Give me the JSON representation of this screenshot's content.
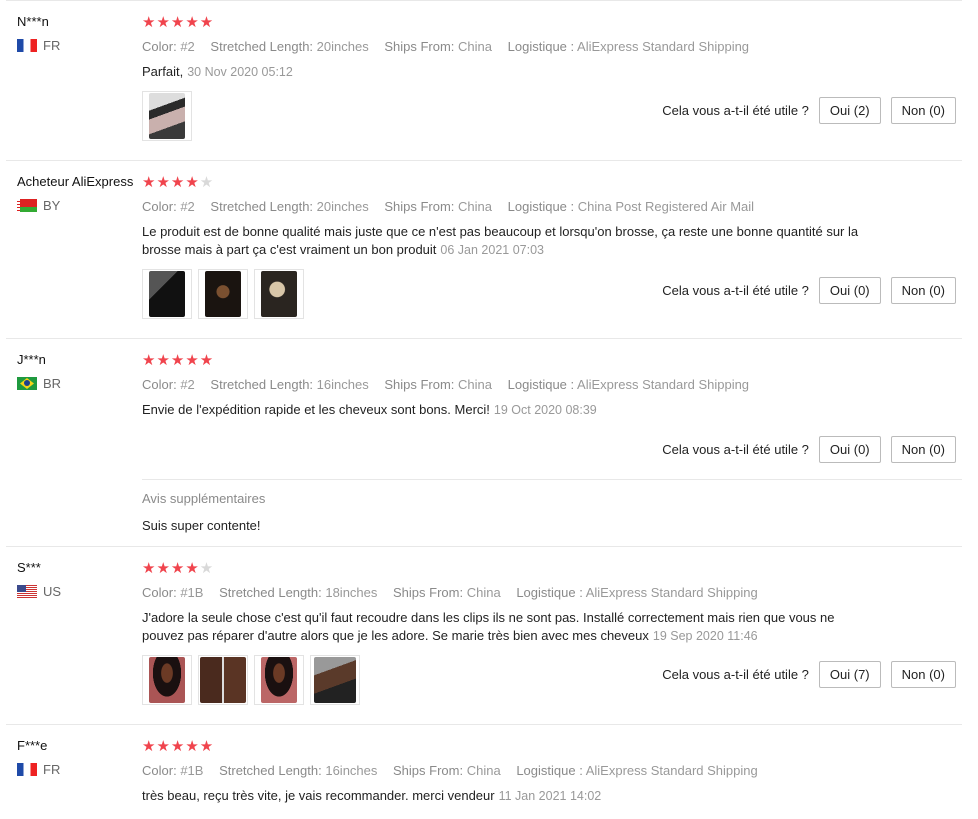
{
  "helpful": {
    "question": "Cela vous a-t-il été utile ?"
  },
  "labels": {
    "color": "Color:",
    "length": "Stretched Length:",
    "ships": "Ships From:",
    "logistics": "Logistique :"
  },
  "reviews": [
    {
      "user": "N***n",
      "country": "FR",
      "flag": "fr",
      "rating": 5,
      "color": "#2",
      "length": "20inches",
      "ships": "China",
      "logistics": "AliExpress Standard Shipping",
      "text": "Parfait,",
      "date": "30 Nov 2020 05:12",
      "photos": [
        "selfie-photo"
      ],
      "yes": "Oui (2)",
      "no": "Non (0)"
    },
    {
      "user": "Acheteur AliExpress",
      "country": "BY",
      "flag": "by",
      "rating": 4,
      "color": "#2",
      "length": "20inches",
      "ships": "China",
      "logistics": "China Post Registered Air Mail",
      "text": "Le produit est de bonne qualité mais juste que ce n'est pas beaucoup et lorsqu'on brosse, ça reste une bonne quantité sur la brosse mais à part ça c'est vraiment un bon produit",
      "date": "06 Jan 2021 07:03",
      "photos": [
        "hair-photo-1",
        "hair-photo-2",
        "hair-photo-3"
      ],
      "yes": "Oui (0)",
      "no": "Non (0)"
    },
    {
      "user": "J***n",
      "country": "BR",
      "flag": "br",
      "rating": 5,
      "color": "#2",
      "length": "16inches",
      "ships": "China",
      "logistics": "AliExpress Standard Shipping",
      "text": "Envie de l'expédition rapide et les cheveux sont bons. Merci!",
      "date": "19 Oct 2020 08:39",
      "photos": [],
      "yes": "Oui (0)",
      "no": "Non (0)",
      "followup_title": "Avis supplémentaires",
      "followup_text": "Suis super contente!"
    },
    {
      "user": "S***",
      "country": "US",
      "flag": "us",
      "rating": 4,
      "color": "#1B",
      "length": "18inches",
      "ships": "China",
      "logistics": "AliExpress Standard Shipping",
      "text": "J'adore la seule chose c'est qu'il faut recoudre dans les clips ils ne sont pas. Installé correctement mais rien que vous ne pouvez pas réparer d'autre alors que je les adore. Se marie très bien avec mes cheveux",
      "date": "19 Sep 2020 11:46",
      "photos": [
        "customer-photo-1",
        "customer-photo-2",
        "customer-photo-3",
        "customer-photo-4"
      ],
      "yes": "Oui (7)",
      "no": "Non (0)"
    },
    {
      "user": "F***e",
      "country": "FR",
      "flag": "fr",
      "rating": 5,
      "color": "#1B",
      "length": "16inches",
      "ships": "China",
      "logistics": "AliExpress Standard Shipping",
      "text": "très beau, reçu très vite, je vais recommander. merci vendeur",
      "date": "11 Jan 2021 14:02",
      "photos": []
    }
  ]
}
